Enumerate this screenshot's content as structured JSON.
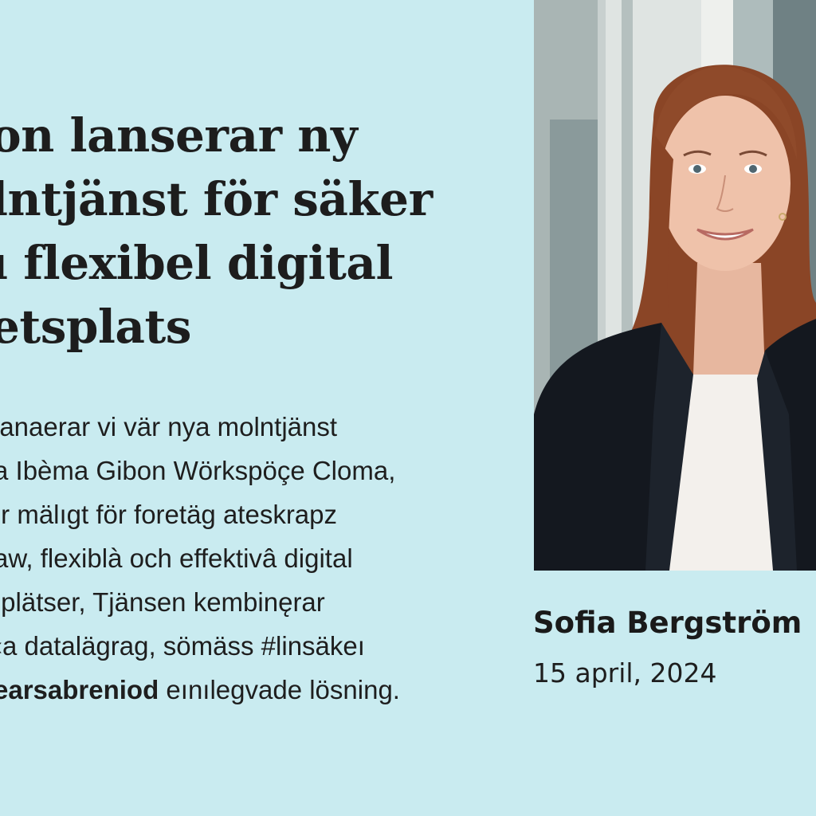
{
  "article": {
    "headline_lines": [
      "on lanserar ny",
      "lntjänst för säker",
      "ı flexibel digital",
      "etsplats"
    ],
    "body_lines": [
      "ianaerar vi vär nya molntjänst",
      "a Ibèma Gibon Wörkspöçe Cloma,",
      "ır mälıgt för foretäg ateskrapz",
      "aw, flexiblà och effektivâ digital",
      "ıplätser, Tjänsen kembinęrar",
      "‹a datalägrag, sömäss #linsäkeı",
      "earsabreniod",
      "eınılegvade lösning."
    ]
  },
  "author": {
    "name": "Sofia Bergström",
    "date": "15 april, 2024",
    "photo_icon": "portrait-photo"
  },
  "colors": {
    "background": "#c9ebf0",
    "text": "#1d1d1d",
    "jacket": "#14181f",
    "hair": "#8a4526"
  }
}
